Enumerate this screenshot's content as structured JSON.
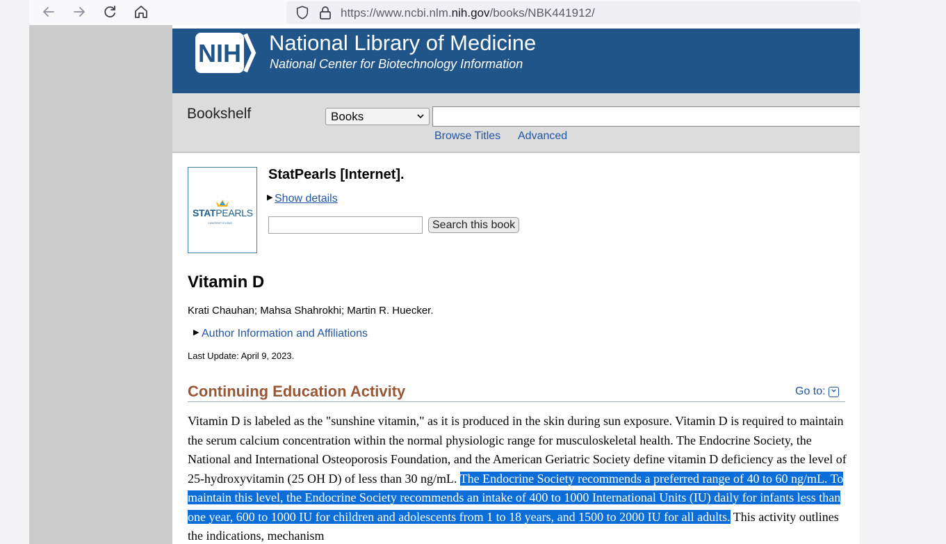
{
  "browser": {
    "url_prefix": "https://www.ncbi.nlm.",
    "url_domain": "nih.gov",
    "url_path": "/books/NBK441912/"
  },
  "header": {
    "logo_text": "NIH",
    "title": "National Library of Medicine",
    "subtitle": "National Center for Biotechnology Information"
  },
  "search": {
    "section_label": "Bookshelf",
    "db_selected": "Books",
    "browse_titles": "Browse Titles",
    "advanced": "Advanced"
  },
  "book": {
    "cover_logo_bold": "STAT",
    "cover_logo_light": "PEARLS",
    "cover_tagline": "CONTENT IS KING",
    "title": "StatPearls [Internet].",
    "show_details": "Show details",
    "search_button": "Search this book"
  },
  "article": {
    "title": "Vitamin D",
    "authors": "Krati Chauhan; Mahsa Shahrokhi; Martin R. Huecker.",
    "affiliations_link": "Author Information and Affiliations",
    "last_update": "Last Update: April 9, 2023."
  },
  "section": {
    "heading": "Continuing Education Activity",
    "goto": "Go to:",
    "text_before": "Vitamin D is labeled as the \"sunshine vitamin,\" as it is produced in the skin during sun exposure. Vitamin D is required to maintain the serum calcium concentration within the normal physiologic range for musculoskeletal health. The Endocrine Society, the National and International Osteoporosis Foundation, and the American Geriatric Society define vitamin D deficiency as the level of 25-hydroxyvitamin (25 OH D) of less than 30 ng/mL. ",
    "text_selected": "The Endocrine Society recommends a preferred range of 40 to 60 ng/mL. To maintain this level, the Endocrine Society recommends an intake of 400 to 1000 International Units (IU) daily for infants less than one year, 600 to 1000 IU for children and adolescents from 1 to 18 years, and 1500 to 2000 IU for all adults.",
    "text_after": " This activity outlines the indications, mechanism"
  },
  "colors": {
    "header_blue": "#20558a",
    "link_blue": "#2056a6",
    "section_brown": "#985735",
    "selection_blue": "#0a6dd8"
  }
}
